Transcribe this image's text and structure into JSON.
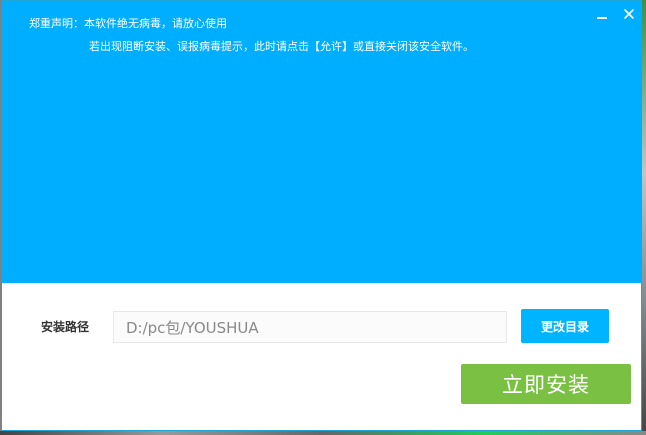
{
  "notice": {
    "line1": "郑重声明：本软件绝无病毒，请放心使用",
    "line2": "若出现阻断安装、误报病毒提示，此时请点击【允许】或直接关闭该安全软件。"
  },
  "window_controls": {
    "minimize_icon": "minimize-icon",
    "close_icon": "close-icon"
  },
  "install_path": {
    "label": "安装路径",
    "value": "D:/pc包/YOUSHUA"
  },
  "buttons": {
    "change_dir_label": "更改目录",
    "install_label": "立即安装"
  },
  "colors": {
    "banner": "#00aeff",
    "change_dir_button": "#00b4ff",
    "install_button": "#7ac143"
  }
}
